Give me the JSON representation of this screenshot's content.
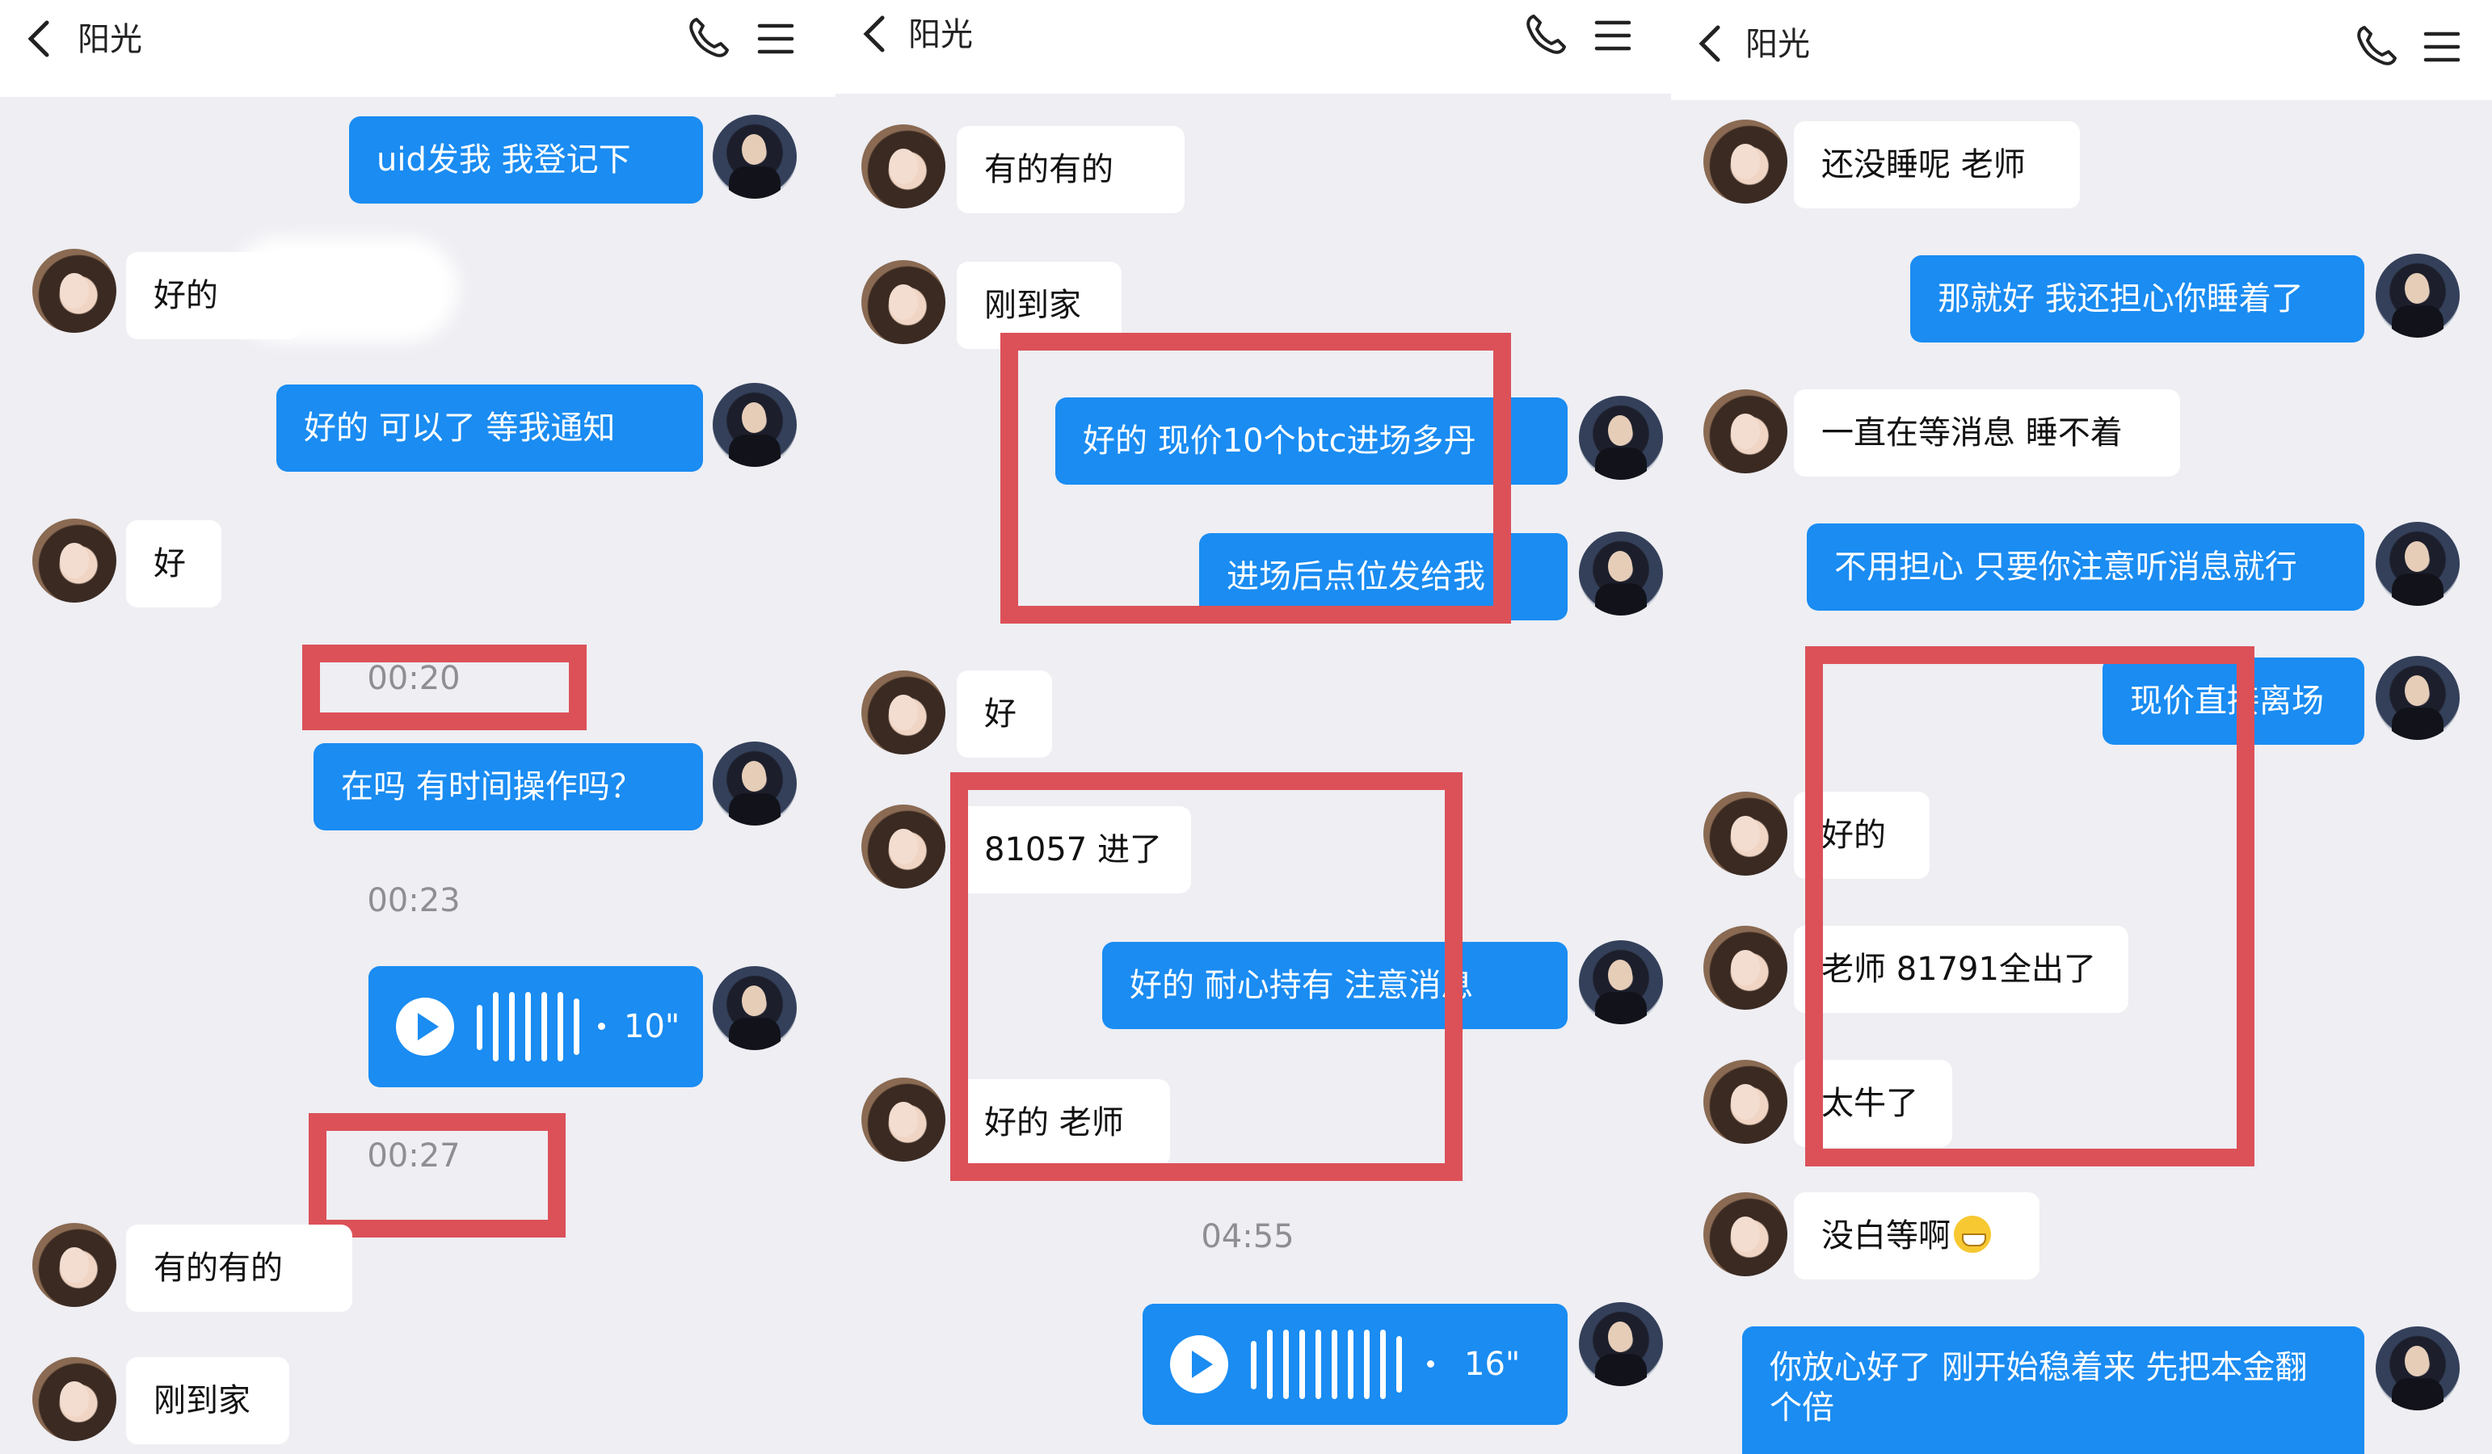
{
  "contact_name": "阳光",
  "panel1": {
    "messages": [
      "uid发我  我登记下",
      "好的  ",
      "好的  可以了  等我通知",
      "好",
      "在吗  有时间操作吗？",
      "有的有的",
      "刚到家"
    ],
    "times": [
      "00:20",
      "00:23",
      "00:27"
    ],
    "voice_length": "10\""
  },
  "panel2": {
    "messages": [
      "有的有的",
      "刚到家",
      "好的  现价10个btc进场多丹",
      "进场后点位发给我",
      "好",
      "81057 进了",
      "好的 耐心持有  注意消息",
      "好的  老师"
    ],
    "times": [
      "04:55"
    ],
    "voice_length": "16\""
  },
  "panel3": {
    "messages": [
      "还没睡呢  老师",
      "那就好  我还担心你睡着了",
      "一直在等消息  睡不着",
      "不用担心  只要你注意听消息就行",
      "现价直接离场",
      "好的",
      "老师  81791全出了",
      "太牛了",
      "没白等啊",
      "你放心好了   刚开始稳着来  先把本金翻个倍"
    ]
  },
  "colors": {
    "bubble_out": "#1a8cf2",
    "bubble_in": "#ffffff",
    "background": "#eeeef3",
    "highlight_box": "#dc5158"
  },
  "icons": [
    "back-icon",
    "phone-icon",
    "menu-icon",
    "play-icon",
    "wave-icon",
    "grin-emoji-icon"
  ]
}
